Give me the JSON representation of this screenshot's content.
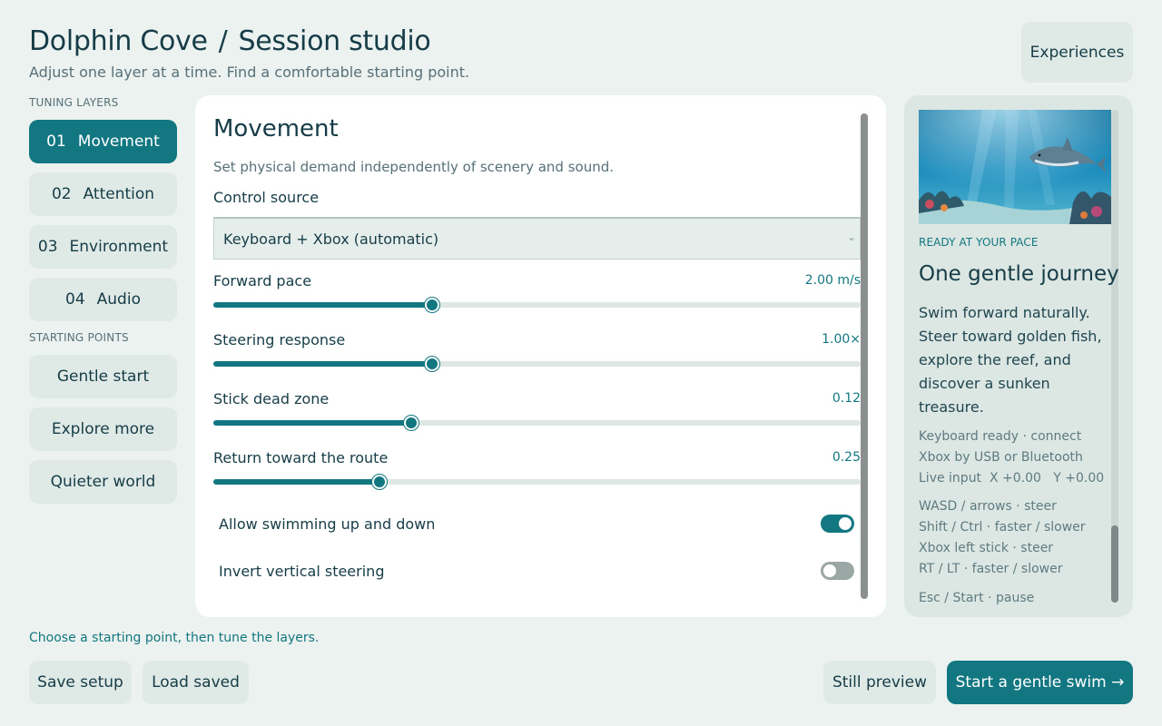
{
  "header": {
    "app": "Dolphin Cove",
    "separator": "/",
    "page": "Session studio",
    "subtitle": "Adjust one layer at a time. Find a comfortable starting point.",
    "experiences_label": "Experiences"
  },
  "sidebar": {
    "layers_heading": "TUNING LAYERS",
    "layers": [
      {
        "num": "01",
        "label": "Movement"
      },
      {
        "num": "02",
        "label": "Attention"
      },
      {
        "num": "03",
        "label": "Environment"
      },
      {
        "num": "04",
        "label": "Audio"
      }
    ],
    "presets_heading": "STARTING POINTS",
    "presets": [
      "Gentle start",
      "Explore more",
      "Quieter world"
    ]
  },
  "movement": {
    "title": "Movement",
    "description": "Set physical demand independently of scenery and sound.",
    "control_source_label": "Control source",
    "control_source_value": "Keyboard + Xbox (automatic)",
    "sliders": [
      {
        "label": "Forward pace",
        "value_text": "2.00 m/s",
        "fraction": 0.338
      },
      {
        "label": "Steering response",
        "value_text": "1.00×",
        "fraction": 0.338
      },
      {
        "label": "Stick dead zone",
        "value_text": "0.12",
        "fraction": 0.306
      },
      {
        "label": "Return toward the route",
        "value_text": "0.25",
        "fraction": 0.257
      }
    ],
    "toggles": [
      {
        "label": "Allow swimming up and down",
        "on": true
      },
      {
        "label": "Invert vertical steering",
        "on": false
      }
    ]
  },
  "preview": {
    "ready": "READY AT YOUR PACE",
    "title": "One gentle journey",
    "story": "Swim forward naturally. Steer toward golden fish, explore the reef, and discover a sunken treasure.",
    "status_lines": [
      "Keyboard ready · connect",
      "Xbox by USB or Bluetooth",
      "Live input  X +0.00   Y +0.00"
    ],
    "controls": [
      "WASD / arrows · steer",
      "Shift / Ctrl · faster / slower",
      "Xbox left stick · steer",
      "RT / LT · faster / slower"
    ],
    "extra": "Esc / Start · pause"
  },
  "footer": {
    "message": "Choose a starting point, then tune the layers.",
    "save": "Save setup",
    "load": "Load saved",
    "still": "Still preview",
    "start": "Start a gentle swim →"
  },
  "colors": {
    "accent": "#127780",
    "background": "#ecf2ef",
    "button": "#dfe9e5"
  }
}
